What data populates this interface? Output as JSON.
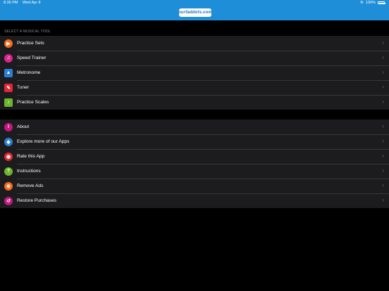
{
  "status": {
    "time": "8:35 PM",
    "date": "Wed Apr 8",
    "battery": "100%"
  },
  "header": {
    "logo": "ourfaddots.com"
  },
  "sections": {
    "tools_title": "SELECT A MUSICAL TOOL",
    "tools": [
      {
        "label": "Practice Sets",
        "icon": "practice-sets-icon",
        "glyph": "▶",
        "color": "#f26b1d"
      },
      {
        "label": "Speed Trainer",
        "icon": "speed-trainer-icon",
        "glyph": "♫",
        "color": "#d9258b"
      },
      {
        "label": "Metronome",
        "icon": "metronome-icon",
        "glyph": "▲",
        "color": "#2a7fd4"
      },
      {
        "label": "Tuner",
        "icon": "tuner-icon",
        "glyph": "✎",
        "color": "#e32636"
      },
      {
        "label": "Practice Scales",
        "icon": "practice-scales-icon",
        "glyph": "♪",
        "color": "#6cb52d"
      }
    ],
    "more": [
      {
        "label": "About",
        "icon": "info-icon",
        "glyph": "i",
        "color": "#c2187f"
      },
      {
        "label": "Explore more of our Apps",
        "icon": "explore-icon",
        "glyph": "◆",
        "color": "#2a7fd4"
      },
      {
        "label": "Rate this App",
        "icon": "rate-icon",
        "glyph": "◉",
        "color": "#e32636"
      },
      {
        "label": "Instructions",
        "icon": "instructions-icon",
        "glyph": "?",
        "color": "#6cb52d"
      },
      {
        "label": "Remove Ads",
        "icon": "remove-ads-icon",
        "glyph": "⊗",
        "color": "#f26b1d"
      },
      {
        "label": "Restore Purchases",
        "icon": "restore-purchases-icon",
        "glyph": "↺",
        "color": "#c2187f"
      }
    ]
  }
}
